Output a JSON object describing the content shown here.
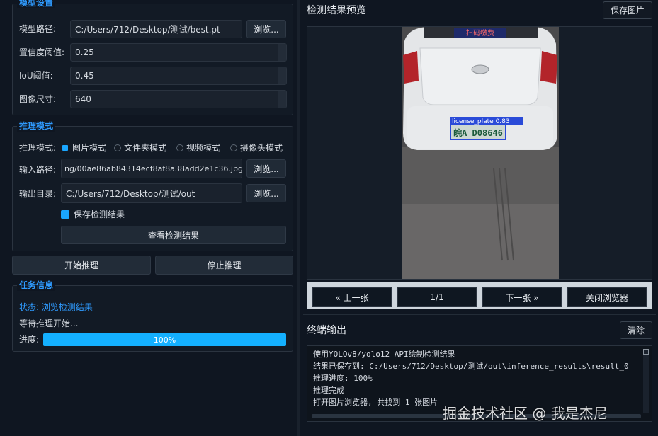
{
  "model_group": {
    "title": "模型设置",
    "path_label": "模型路径:",
    "path_value": "C:/Users/712/Desktop/测试/best.pt",
    "browse": "浏览...",
    "conf_label": "置信度阈值:",
    "conf_value": "0.25",
    "iou_label": "IoU阈值:",
    "iou_value": "0.45",
    "size_label": "图像尺寸:",
    "size_value": "640"
  },
  "infer_group": {
    "title": "推理模式",
    "mode_label": "推理模式:",
    "modes": [
      "图片模式",
      "文件夹模式",
      "视频模式",
      "摄像头模式"
    ],
    "input_label": "输入路径:",
    "input_value": "ng/00ae86ab84314ecf8af8a38add2e1c36.jpg",
    "output_label": "输出目录:",
    "output_value": "C:/Users/712/Desktop/测试/out",
    "browse": "浏览...",
    "save_checkbox": "保存检测结果",
    "view_results": "查看检测结果"
  },
  "actions": {
    "start": "开始推理",
    "stop": "停止推理"
  },
  "task_group": {
    "title": "任务信息",
    "status": "状态: 浏览检测结果",
    "waiting": "等待推理开始...",
    "progress_label": "进度:",
    "progress_text": "100%",
    "progress_value": 1.0
  },
  "preview": {
    "title": "检测结果预览",
    "save_image": "保存图片",
    "detection_label": "license_plate  0.83",
    "plate_text": "皖A D08646",
    "sign_text": "扫码缴费"
  },
  "navigation": {
    "prev": "« 上一张",
    "counter": "1/1",
    "next": "下一张 »",
    "close": "关闭浏览器"
  },
  "terminal": {
    "title": "终端输出",
    "clear": "清除",
    "lines": [
      "使用YOLOv8/yolo12 API绘制检测结果",
      "结果已保存到: C:/Users/712/Desktop/测试/out\\inference_results\\result_0",
      "推理进度: 100%",
      "推理完成",
      "打开图片浏览器, 共找到 1 张图片"
    ]
  },
  "watermark": "掘金技术社区 @ 我是杰尼",
  "colors": {
    "accent": "#1aa6ff",
    "title_blue": "#2f9bff",
    "detection_box": "#2a4bd8",
    "background": "#0f1621"
  }
}
